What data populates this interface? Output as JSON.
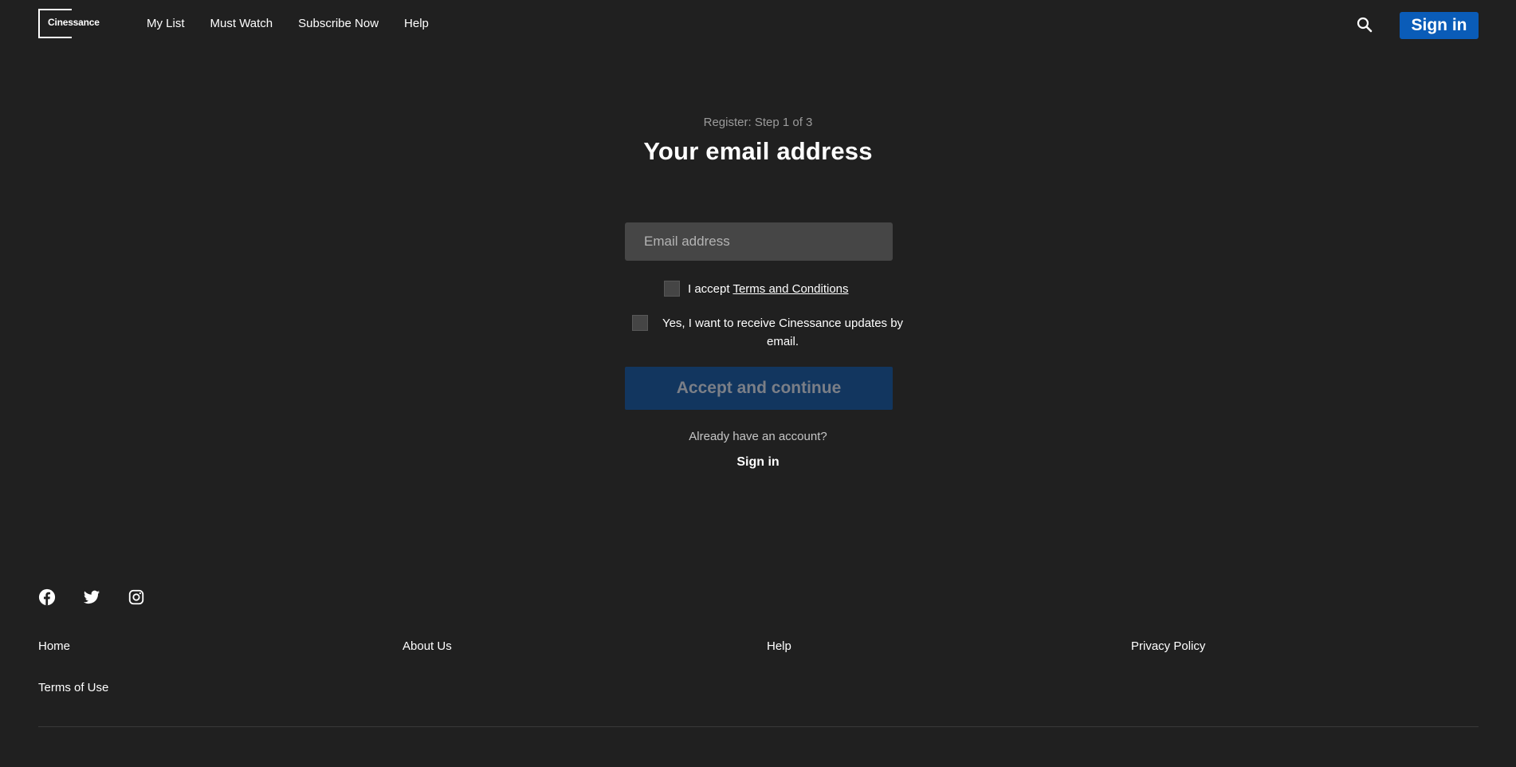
{
  "brand": {
    "name": "Cinessance"
  },
  "nav": {
    "items": [
      {
        "label": "My List"
      },
      {
        "label": "Must Watch"
      },
      {
        "label": "Subscribe Now"
      },
      {
        "label": "Help"
      }
    ],
    "search_icon": "search-icon",
    "signin_label": "Sign in",
    "signin_color": "#0a5cb8"
  },
  "register": {
    "step_label": "Register: Step 1 of 3",
    "title": "Your email address",
    "email_placeholder": "Email address",
    "terms_prefix": "I accept ",
    "terms_link": "Terms and Conditions",
    "updates_label": "Yes, I want to receive Cinessance updates by email.",
    "accept_label": "Accept and continue",
    "already_label": "Already have an account?",
    "signin_label": "Sign in"
  },
  "footer": {
    "social": [
      "facebook-icon",
      "twitter-icon",
      "instagram-icon"
    ],
    "links": [
      {
        "label": "Home"
      },
      {
        "label": "About Us"
      },
      {
        "label": "Help"
      },
      {
        "label": "Privacy Policy"
      },
      {
        "label": "Terms of Use"
      }
    ]
  }
}
